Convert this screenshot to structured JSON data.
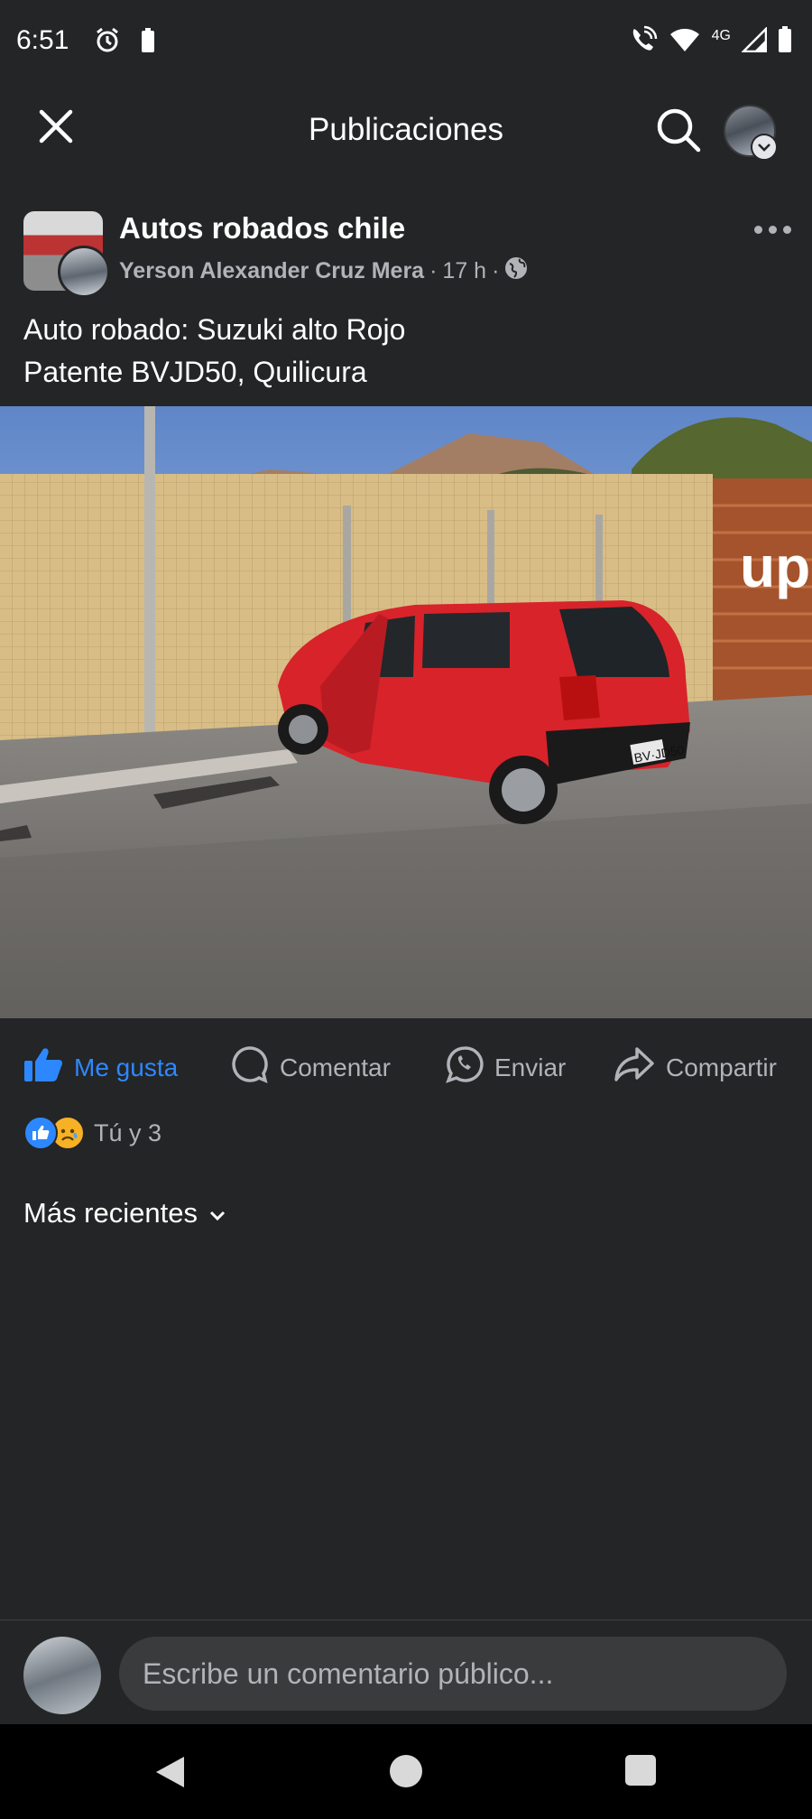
{
  "status_bar": {
    "time": "6:51",
    "network": "4G"
  },
  "top_bar": {
    "title": "Publicaciones"
  },
  "post": {
    "group_name": "Autos robados chile",
    "author": "Yerson Alexander Cruz Mera",
    "time_ago": "17 h",
    "separator": "·",
    "text_line1": "Auto robado: Suzuki alto Rojo",
    "text_line2": "Patente BVJD50, Quilicura",
    "photo": {
      "sign_text": "up",
      "plate_text": "BV·JD50"
    }
  },
  "actions": {
    "like": "Me gusta",
    "comment": "Comentar",
    "send": "Enviar",
    "share": "Compartir"
  },
  "reactions": {
    "summary": "Tú y 3"
  },
  "sort": {
    "label": "Más recientes"
  },
  "composer": {
    "placeholder": "Escribe un comentario público..."
  },
  "colors": {
    "accent": "#2d88ff",
    "background": "#242526",
    "car": "#d8232a"
  }
}
